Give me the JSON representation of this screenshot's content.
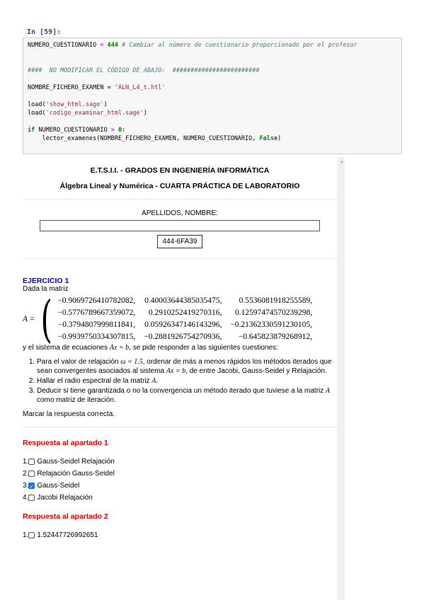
{
  "cell": {
    "prompt": "In [59]:",
    "code": {
      "l1_var": "NUMERO_CUESTIONARIO",
      "l1_eq": " = ",
      "l1_num": "444",
      "l1_comment": " # Cambiar al número de cuestionario proporcionado por el profesor",
      "l2_comment": "####  NO MODIFICAR EL CÓDIGO DE ABAJO:  ########################",
      "l3_var": "NOMBRE_FICHERO_EXAMEN = ",
      "l3_str": "'ALN_L4_t.htl'",
      "l4_fn": "load(",
      "l4_str": "'show_html.sage'",
      "l4_end": ")",
      "l5_fn": "load(",
      "l5_str": "'codigo_examinar_html.sage'",
      "l5_end": ")",
      "l6_if": "if",
      "l6_var": " NUMERO_CUESTIONARIO ",
      "l6_op": ">",
      "l6_num": " 0",
      "l6_end": ":",
      "l7_call": "    lector_examenes(NOMBRE_FICHERO_EXAMEN, NUMERO_CUESTIONARIO, ",
      "l7_kw": "False",
      "l7_end": ")"
    }
  },
  "exam": {
    "header1": "E.T.S.I.I. - GRADOS EN INGENIERÍA INFORMÁTICA",
    "header2": "Álgebra Lineal y Numérica - CUARTA PRÁCTICA DE LABORATORIO",
    "apellidos_label": "APELLIDOS, NOMBRE:",
    "apellidos_value": "",
    "exam_code": "444-6FA39",
    "ejercicio_title": "EJERCICIO 1",
    "intro": "Dada la matriz",
    "matrix_lhs": "A =",
    "matrix": [
      [
        "−0.9069726410782082,",
        "0.40003644385035475,",
        "0.5536081918255589,"
      ],
      [
        "−0.5776789667359072,",
        "0.2910252419270316,",
        "0.12597474570239298,"
      ],
      [
        "−0.3794807999811841,",
        "0.05926347146143296,",
        "−0.21362330591230105,"
      ],
      [
        "−0.9939750334307815,",
        "−0.2881926754270936,",
        "−0.645823879268912,"
      ]
    ],
    "system_pre": "y el sistema de ecuaciones ",
    "system_eq": "Ax = b",
    "system_post": ", se pide responder a las siguientes cuestiones:",
    "questions": [
      {
        "pre": "Para el valor de relajación ",
        "math": "ω = 1.5",
        "mid": ", ordenar de más a menos rápidos los métodos iterados que sean convergentes asociados al sistema ",
        "math2": "Ax = b",
        "post": ", de entre Jacobi, Gauss-Seidel y Relajación."
      },
      {
        "pre": "Hallar el radio espectral de la matriz ",
        "math": "A",
        "post": "."
      },
      {
        "pre": "Deducir si tiene garantizada o no la convergencia un método iterado que tuviese a la matriz ",
        "math": "A",
        "post": " como matriz de iteración."
      }
    ],
    "instruction": "Marcar la respuesta correcta.",
    "answers1": {
      "title": "Respuesta al apartado 1",
      "options": [
        {
          "num": "1.",
          "label": "Gauss-Seidel Relajación",
          "checked": false
        },
        {
          "num": "2.",
          "label": "Relajación Gauss-Seidel",
          "checked": false
        },
        {
          "num": "3.",
          "label": "Gauss-Seidel",
          "checked": true
        },
        {
          "num": "4.",
          "label": "Jacobi Relajación",
          "checked": false
        }
      ]
    },
    "answers2": {
      "title": "Respuesta al apartado 2",
      "options": [
        {
          "num": "1.",
          "label": "1.52447726992651",
          "checked": false
        }
      ]
    }
  }
}
